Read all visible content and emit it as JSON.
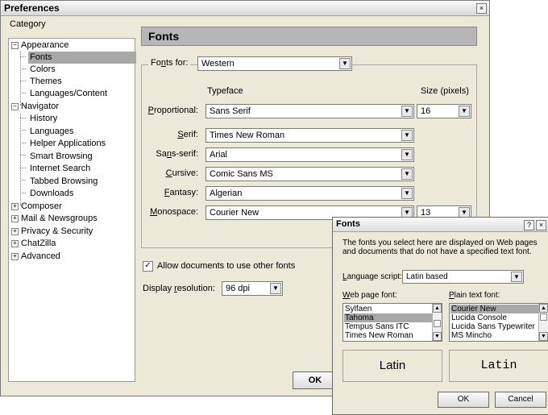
{
  "window": {
    "title": "Preferences",
    "close_glyph": "×"
  },
  "category": {
    "label": "Category",
    "items": [
      {
        "label": "Appearance",
        "expander": "−"
      },
      {
        "label": "Fonts"
      },
      {
        "label": "Colors"
      },
      {
        "label": "Themes"
      },
      {
        "label": "Languages/Content"
      },
      {
        "label": "Navigator",
        "expander": "−"
      },
      {
        "label": "History"
      },
      {
        "label": "Languages"
      },
      {
        "label": "Helper Applications"
      },
      {
        "label": "Smart Browsing"
      },
      {
        "label": "Internet Search"
      },
      {
        "label": "Tabbed Browsing"
      },
      {
        "label": "Downloads"
      },
      {
        "label": "Composer",
        "expander": "+"
      },
      {
        "label": "Mail & Newsgroups",
        "expander": "+"
      },
      {
        "label": "Privacy & Security",
        "expander": "+"
      },
      {
        "label": "ChatZilla",
        "expander": "+"
      },
      {
        "label": "Advanced",
        "expander": "+"
      }
    ]
  },
  "panel": {
    "header": "Fonts",
    "fonts_for": {
      "label_pre": "Fo",
      "label_key": "n",
      "label_post": "ts for:",
      "value": "Western"
    },
    "col_typeface": "Typeface",
    "col_size": "Size (pixels)",
    "rows": {
      "proportional": {
        "key": "P",
        "rest": "roportional:",
        "value": "Sans Serif",
        "size": "16"
      },
      "serif": {
        "key": "S",
        "rest": "erif:",
        "value": "Times New Roman"
      },
      "sans_serif": {
        "pre": "Sa",
        "key": "n",
        "rest": "s-serif:",
        "value": "Arial"
      },
      "cursive": {
        "key": "C",
        "rest": "ursive:",
        "value": "Comic Sans MS"
      },
      "fantasy": {
        "key": "F",
        "rest": "antasy:",
        "value": "Algerian"
      },
      "monospace": {
        "key": "M",
        "rest": "onospace:",
        "value": "Courier New",
        "size": "13"
      }
    },
    "allow_fonts": {
      "label": "Allow documents to use other fonts",
      "checked": true,
      "check_glyph": "✓"
    },
    "resolution": {
      "label_pre": "Display ",
      "label_key": "r",
      "label_post": "esolution:",
      "value": "96 dpi"
    },
    "ok": "OK"
  },
  "fonts_dialog": {
    "title": "Fonts",
    "help_glyph": "?",
    "close_glyph": "×",
    "description": "The fonts you select here are displayed on Web pages and documents that do not have a specified text font.",
    "language_script": {
      "key": "L",
      "rest": "anguage script:",
      "value": "Latin based"
    },
    "web_font": {
      "key": "W",
      "rest": "eb page font:",
      "items": [
        "Sylfaen",
        "Tahoma",
        "Tempus Sans ITC",
        "Times New Roman"
      ],
      "selected": "Tahoma"
    },
    "plain_font": {
      "key": "P",
      "rest": "lain text font:",
      "items": [
        "Courier New",
        "Lucida Console",
        "Lucida Sans Typewriter",
        "MS Mincho"
      ],
      "selected": "Courier New"
    },
    "preview_left": "Latin",
    "preview_right": "Latin",
    "ok": "OK",
    "cancel": "Cancel"
  },
  "icons": {
    "dropdown": "▼",
    "scroll_up": "▲",
    "scroll_down": "▼"
  }
}
